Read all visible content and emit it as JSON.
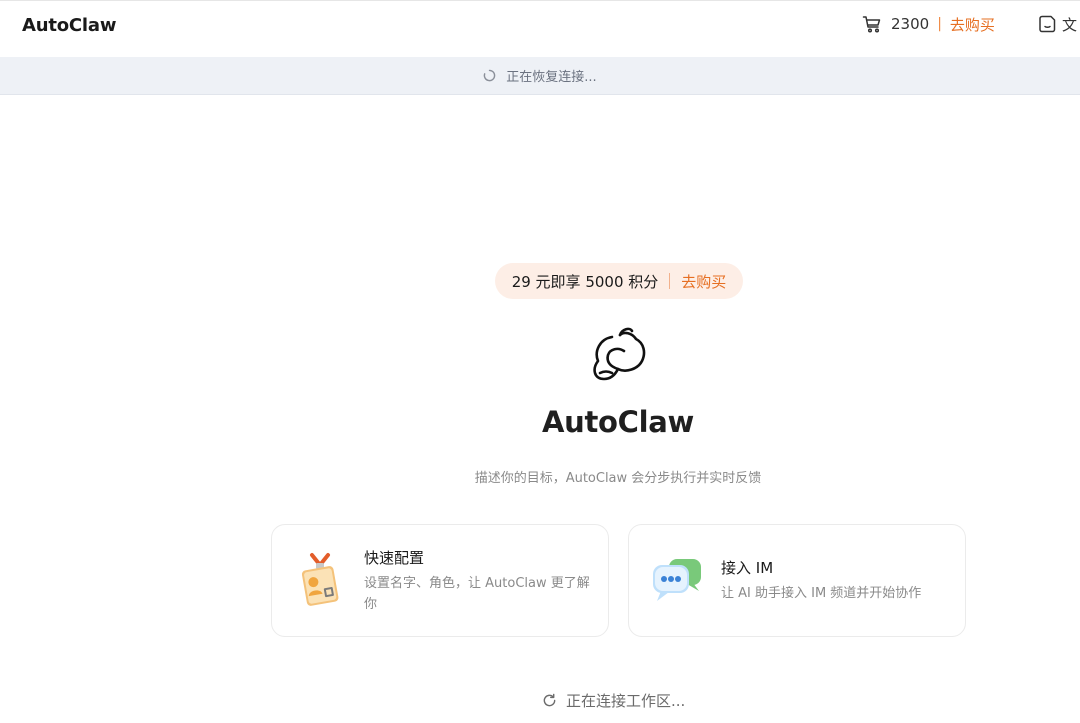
{
  "header": {
    "brand": "AutoClaw",
    "cart_icon": "cart-icon",
    "credits": "2300",
    "separator": "|",
    "buy_label": "去购买",
    "doc_icon": "document-icon",
    "doc_label": "文"
  },
  "banner": {
    "spinner_icon": "loading-spinner-icon",
    "text": "正在恢复连接..."
  },
  "promo": {
    "text": "29 元即享 5000 积分",
    "buy_label": "去购买"
  },
  "hero": {
    "logo_icon": "autoclaw-logo",
    "title": "AutoClaw",
    "subtitle": "描述你的目标，AutoClaw 会分步执行并实时反馈"
  },
  "cards": [
    {
      "icon": "id-badge-icon",
      "title": "快速配置",
      "desc": "设置名字、角色，让 AutoClaw 更了解你"
    },
    {
      "icon": "chat-bubbles-icon",
      "title": "接入 IM",
      "desc": "让 AI 助手接入 IM 频道并开始协作"
    }
  ],
  "footer": {
    "icon": "refresh-icon",
    "text": "正在连接工作区..."
  },
  "colors": {
    "accent": "#e66f22",
    "banner_bg": "#eef1f6",
    "promo_bg": "#fdeee6"
  }
}
